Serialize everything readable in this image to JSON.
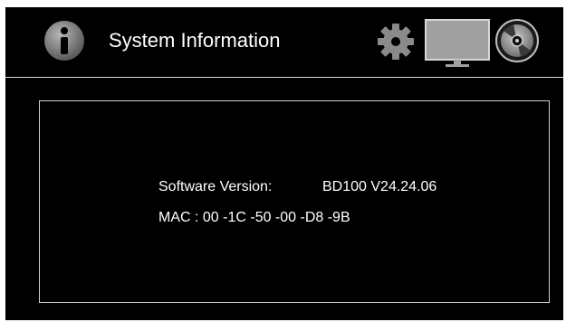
{
  "header": {
    "title": "System Information",
    "icons": [
      "info-icon",
      "gear-icon",
      "monitor-icon",
      "disc-icon"
    ],
    "active_icon": "monitor-icon"
  },
  "info": {
    "software_version_label": "Software Version:",
    "software_version_value": "BD100 V24.24.06",
    "mac_text": "MAC : 00 -1C -50 -00 -D8 -9B"
  },
  "colors": {
    "background": "#000000",
    "text": "#ffffff",
    "border": "#d0d0d0",
    "icon_gray": "#8a8a8a",
    "monitor_fill": "#a0a0a0"
  }
}
